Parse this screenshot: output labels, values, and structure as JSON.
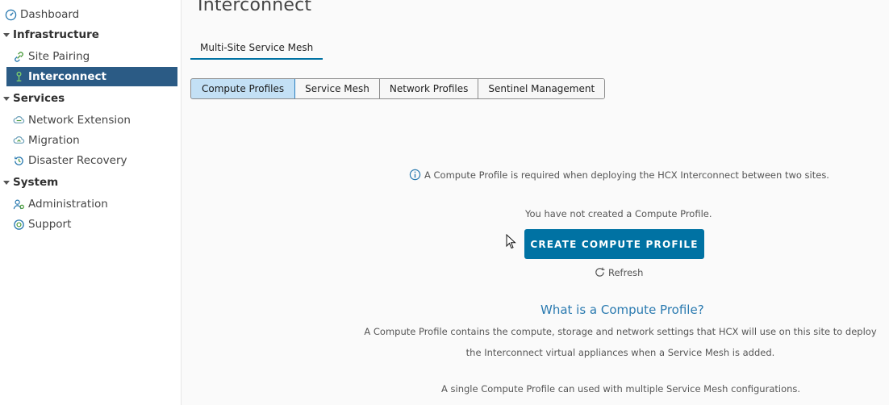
{
  "sidebar": {
    "dashboard": "Dashboard",
    "sections": {
      "infrastructure": "Infrastructure",
      "services": "Services",
      "system": "System"
    },
    "items": {
      "site_pairing": "Site Pairing",
      "interconnect": "Interconnect",
      "network_extension": "Network Extension",
      "migration": "Migration",
      "disaster_recovery": "Disaster Recovery",
      "administration": "Administration",
      "support": "Support"
    },
    "active_item": "interconnect"
  },
  "main": {
    "title": "Interconnect",
    "primary_tab": "Multi-Site Service Mesh",
    "sub_tabs": [
      "Compute Profiles",
      "Service Mesh",
      "Network Profiles",
      "Sentinel Management"
    ],
    "active_sub_tab": "Compute Profiles",
    "info_text": "A Compute Profile is required when deploying the HCX Interconnect between two sites.",
    "empty_text": "You have not created a Compute Profile.",
    "create_button": "CREATE COMPUTE PROFILE",
    "refresh_label": "Refresh",
    "what_title": "What is a Compute Profile?",
    "description_line1": "A Compute Profile contains the compute, storage and network settings that HCX will use on this site to deploy",
    "description_line2": "the Interconnect virtual appliances when a Service Mesh is added.",
    "description_line3": "A single Compute Profile can used with multiple Service Mesh configurations."
  },
  "colors": {
    "sidebar_active_bg": "#2b5b85",
    "primary_button": "#0072a3",
    "link_blue": "#2a7ab0",
    "icon_green": "#4a9a3a",
    "icon_blue": "#2a7ab0"
  },
  "icons": {
    "dashboard": "speedometer-icon",
    "site_pairing": "link-icon",
    "interconnect": "interconnect-icon",
    "network_extension": "cloud-network-icon",
    "migration": "cloud-migrate-icon",
    "disaster_recovery": "history-icon",
    "administration": "user-gear-icon",
    "support": "lifebuoy-icon",
    "info": "info-circle-icon",
    "refresh": "refresh-icon"
  }
}
